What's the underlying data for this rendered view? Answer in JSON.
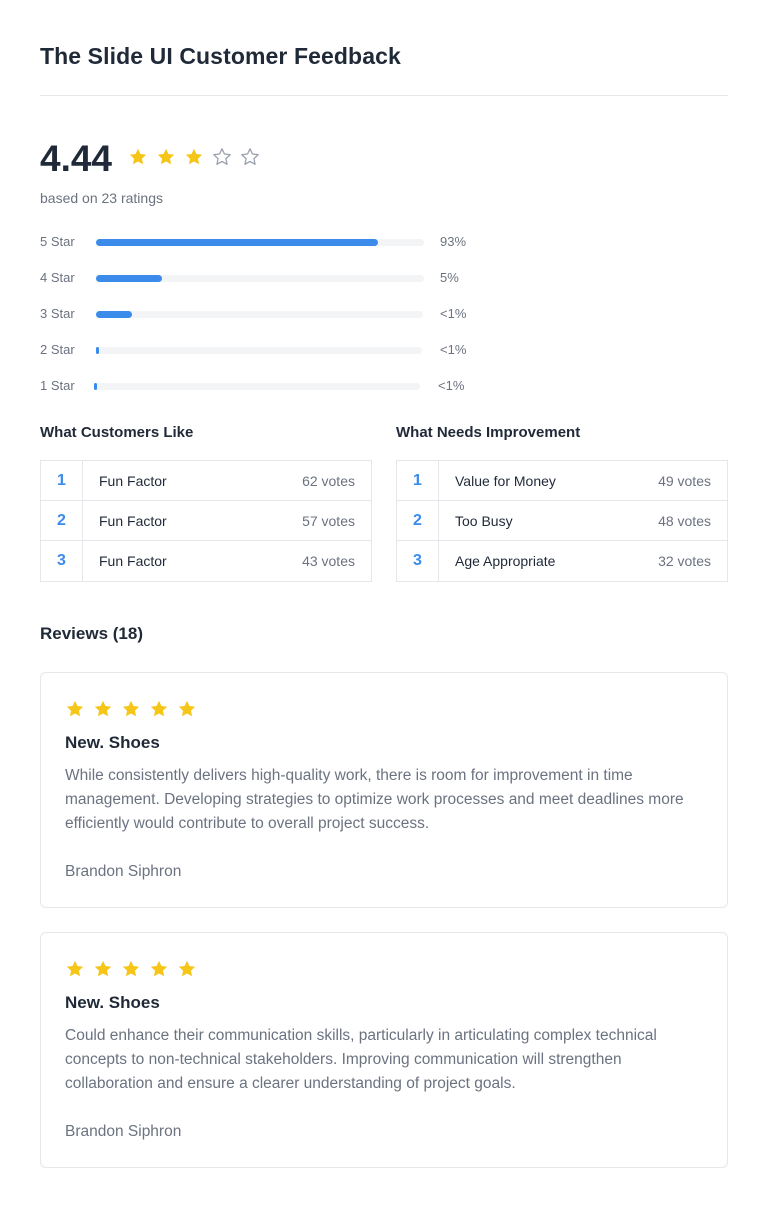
{
  "page": {
    "title": "The Slide UI Customer Feedback"
  },
  "rating": {
    "average": "4.44",
    "stars_filled": 3,
    "stars_total": 5,
    "based_on": "based on 23 ratings"
  },
  "distribution": [
    {
      "label": "5 Star",
      "percent_text": "93%",
      "fill_fraction": 0.86
    },
    {
      "label": "4 Star",
      "percent_text": "5%",
      "fill_fraction": 0.2
    },
    {
      "label": "3 Star",
      "percent_text": "<1%",
      "fill_fraction": 0.11
    },
    {
      "label": "2 Star",
      "percent_text": "<1%",
      "fill_fraction": 0.01
    },
    {
      "label": "1 Star",
      "percent_text": "<1%",
      "fill_fraction": 0.01
    }
  ],
  "likes": {
    "heading": "What Customers Like",
    "rows": [
      {
        "rank": "1",
        "name": "Fun Factor",
        "votes": "62 votes"
      },
      {
        "rank": "2",
        "name": "Fun Factor",
        "votes": "57 votes"
      },
      {
        "rank": "3",
        "name": "Fun Factor",
        "votes": "43 votes"
      }
    ]
  },
  "improvements": {
    "heading": "What Needs Improvement",
    "rows": [
      {
        "rank": "1",
        "name": "Value for Money",
        "votes": "49 votes"
      },
      {
        "rank": "2",
        "name": "Too Busy",
        "votes": "48 votes"
      },
      {
        "rank": "3",
        "name": "Age Appropriate",
        "votes": "32 votes"
      }
    ]
  },
  "reviews": {
    "heading": "Reviews (18)",
    "items": [
      {
        "stars": 5,
        "title": "New. Shoes",
        "body": "While consistently delivers high-quality work, there is room for improvement in time management. Developing strategies to optimize work processes and meet deadlines more efficiently would contribute to overall project success.",
        "author": "Brandon Siphron"
      },
      {
        "stars": 5,
        "title": "New. Shoes",
        "body": "Could enhance their communication skills, particularly in articulating complex technical concepts to non-technical stakeholders. Improving communication will strengthen collaboration and ensure a clearer understanding of project goals.",
        "author": "Brandon Siphron"
      }
    ]
  },
  "colors": {
    "star_filled": "#f5c518",
    "star_empty": "#9ca3af",
    "accent": "#3b8beb"
  },
  "icons": {
    "star_filled": "star-filled-icon",
    "star_empty": "star-outline-icon"
  }
}
